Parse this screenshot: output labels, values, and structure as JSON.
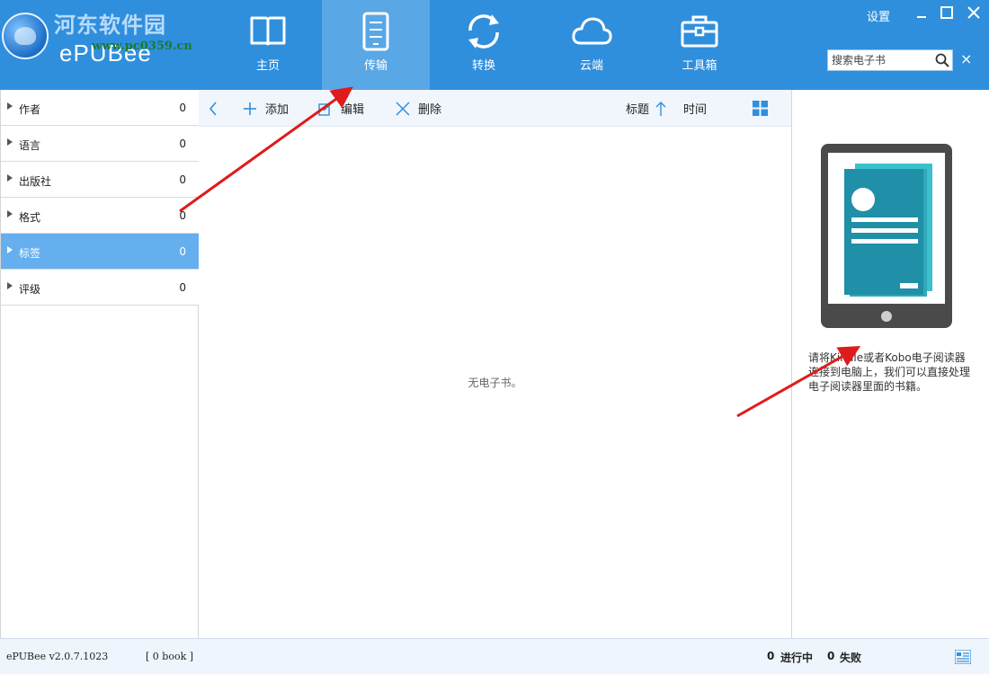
{
  "header": {
    "watermark_text": "河东软件园",
    "watermark_url": "www.pc0359.cn",
    "app_name": "ePUBee",
    "settings_label": "设置",
    "search": {
      "placeholder": "搜索电子书",
      "value": ""
    },
    "nav_tabs": [
      {
        "label": "主页",
        "icon": "book-open-icon",
        "active": false
      },
      {
        "label": "传输",
        "icon": "ereader-icon",
        "active": true
      },
      {
        "label": "转换",
        "icon": "convert-icon",
        "active": false
      },
      {
        "label": "云端",
        "icon": "cloud-icon",
        "active": false
      },
      {
        "label": "工具箱",
        "icon": "toolbox-icon",
        "active": false
      }
    ],
    "window_controls": [
      "minimize-icon",
      "maximize-icon",
      "close-icon"
    ]
  },
  "sidebar": {
    "items": [
      {
        "label": "作者",
        "count": "0",
        "selected": false
      },
      {
        "label": "语言",
        "count": "0",
        "selected": false
      },
      {
        "label": "出版社",
        "count": "0",
        "selected": false
      },
      {
        "label": "格式",
        "count": "0",
        "selected": false
      },
      {
        "label": "标签",
        "count": "0",
        "selected": true
      },
      {
        "label": "评级",
        "count": "0",
        "selected": false
      }
    ]
  },
  "toolbar": {
    "back_icon": "chevron-left-icon",
    "add_label": "添加",
    "edit_label": "编辑",
    "delete_label": "删除",
    "sort_title_label": "标题",
    "sort_direction": "ascending",
    "sort_time_label": "时间",
    "view_icon": "grid-view-icon"
  },
  "content": {
    "empty_message": "无电子书。"
  },
  "right_panel": {
    "hint": "请将Kindle或者Kobo电子阅读器连接到电脑上，我们可以直接处理电子阅读器里面的书籍。"
  },
  "statusbar": {
    "version": "ePUBee v2.0.7.1023",
    "book_count": "[ 0 book ]",
    "in_progress_count": "0",
    "in_progress_label": "进行中",
    "failed_count": "0",
    "failed_label": "失败"
  },
  "colors": {
    "header_bg": "#2f8fdd",
    "active_tab_bg": "#5aa7e6",
    "sidebar_selected": "#66afee",
    "toolbar_bg": "#f0f6fc",
    "accent_icon": "#2f8fdd",
    "annotation_arrow": "#e01b1b"
  }
}
